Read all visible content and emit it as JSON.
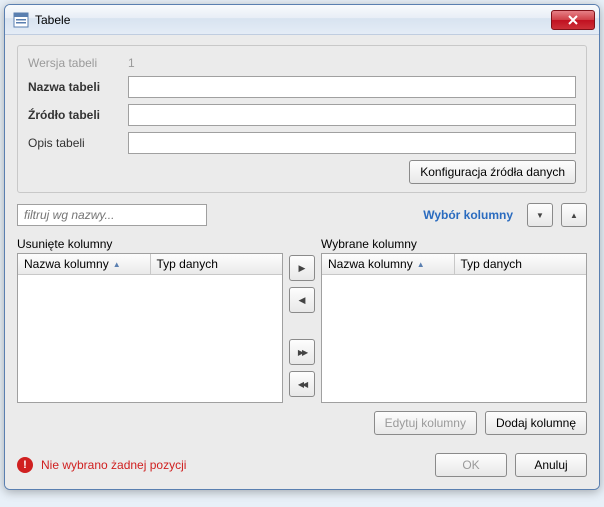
{
  "window": {
    "title": "Tabele"
  },
  "form": {
    "version_label": "Wersja tabeli",
    "version_value": "1",
    "name_label": "Nazwa tabeli",
    "name_value": "",
    "source_label": "Źródło tabeli",
    "source_value": "",
    "desc_label": "Opis tabeli",
    "desc_value": "",
    "config_btn": "Konfiguracja źródła danych"
  },
  "filter": {
    "placeholder": "filtruj wg nazwy..."
  },
  "selection": {
    "label": "Wybór kolumny"
  },
  "left": {
    "title": "Usunięte kolumny",
    "col1": "Nazwa kolumny",
    "col2": "Typ danych"
  },
  "right": {
    "title": "Wybrane kolumny",
    "col1": "Nazwa kolumny",
    "col2": "Typ danych"
  },
  "actions": {
    "edit": "Edytuj kolumny",
    "add": "Dodaj kolumnę",
    "ok": "OK",
    "cancel": "Anuluj"
  },
  "error": {
    "text": "Nie wybrano żadnej pozycji"
  },
  "icons": {
    "right_single": "▶",
    "left_single": "◀",
    "right_double": "▶▶",
    "left_double": "◀◀",
    "down": "▼",
    "up": "▲",
    "sort_asc": "▲"
  }
}
